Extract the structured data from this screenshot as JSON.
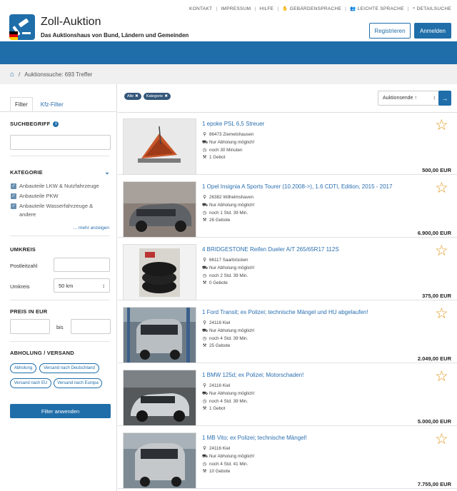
{
  "top_links": [
    {
      "label": "KONTAKT",
      "icon": ""
    },
    {
      "label": "IMPRESSUM",
      "icon": ""
    },
    {
      "label": "HILFE",
      "icon": ""
    },
    {
      "label": "GEBÄRDENSPRACHE",
      "icon": "sign-language-icon"
    },
    {
      "label": "LEICHTE SPRACHE",
      "icon": "easy-language-icon"
    },
    {
      "label": "DETAILSUCHE",
      "icon": "search-icon"
    }
  ],
  "header": {
    "title": "Zoll-Auktion",
    "subtitle": "Das Auktionshaus von Bund, Ländern und Gemeinden",
    "register_label": "Registrieren",
    "login_label": "Anmelden"
  },
  "breadcrumb": {
    "separator": "/",
    "text": "Auktionssuche: 693 Treffer"
  },
  "sidebar": {
    "tabs": [
      "Filter",
      "Kfz-Filter"
    ],
    "search_title": "SUCHBEGRIFF",
    "search_value": "",
    "category_title": "KATEGORIE",
    "categories": [
      "Anbauteile LKW & Nutzfahrzeuge",
      "Anbauteile PKW",
      "Anbauteile Wasserfahrzeuge & andere"
    ],
    "more_label": "... mehr anzeigen",
    "radius_title": "UMKREIS",
    "postcode_label": "Postleitzahl",
    "postcode_value": "",
    "radius_label": "Umkreis",
    "radius_value": "50 km",
    "price_title": "PREIS IN EUR",
    "price_to_label": "bis",
    "shipping_title": "ABHOLUNG / VERSAND",
    "shipping_options": [
      "Abholung",
      "Versand nach Deutschland",
      "Versand nach EU",
      "Versand nach Europa"
    ],
    "apply_label": "Filter anwenden"
  },
  "main": {
    "chips": [
      "Alle",
      "Kategorie"
    ],
    "sort_label": "Auktionsende ↑",
    "sort_go_label": "→",
    "items": [
      {
        "title": "1 epoke PSL 6,5 Streuer",
        "location": "86473 Ziemetshausen",
        "pickup": "Nur Abholung möglich!",
        "time": "noch 30 Minuten",
        "bids": "1 Gebot",
        "price": "500,00 EUR"
      },
      {
        "title": "1 Opel Insignia A Sports Tourer (10.2008->), 1.6 CDTI, Edition, 2015 - 2017",
        "location": "26382 Wilhelmshaven",
        "pickup": "Nur Abholung möglich!",
        "time": "noch 1 Std. 39 Min.",
        "bids": "26 Gebote",
        "price": "6.900,00 EUR"
      },
      {
        "title": "4 BRIDGESTONE Reifen Dueler A/T 265/65R17 112S",
        "location": "66117 Saarbrücken",
        "pickup": "Nur Abholung möglich!",
        "time": "noch 2 Std. 39 Min.",
        "bids": "0 Gebote",
        "price": "375,00 EUR"
      },
      {
        "title": "1 Ford Transit; ex Polizei; technische Mängel und HU abgelaufen!",
        "location": "24116 Kiel",
        "pickup": "Nur Abholung möglich!",
        "time": "noch 4 Std. 39 Min.",
        "bids": "25 Gebote",
        "price": "2.049,00 EUR"
      },
      {
        "title": "1 BMW 125d; ex Polizei; Motorschaden!",
        "location": "24116 Kiel",
        "pickup": "Nur Abholung möglich!",
        "time": "noch 4 Std. 39 Min.",
        "bids": "1 Gebot",
        "price": "5.000,00 EUR"
      },
      {
        "title": "1 MB Vito; ex Polizei; technische Mängel!",
        "location": "24116 Kiel",
        "pickup": "Nur Abholung möglich!",
        "time": "noch 4 Std. 41 Min.",
        "bids": "10 Gebote",
        "price": "7.755,00 EUR"
      }
    ]
  },
  "colors": {
    "primary": "#1f6ea9",
    "link": "#2a6fb0",
    "star": "#e29a24",
    "chip": "#34577a"
  }
}
